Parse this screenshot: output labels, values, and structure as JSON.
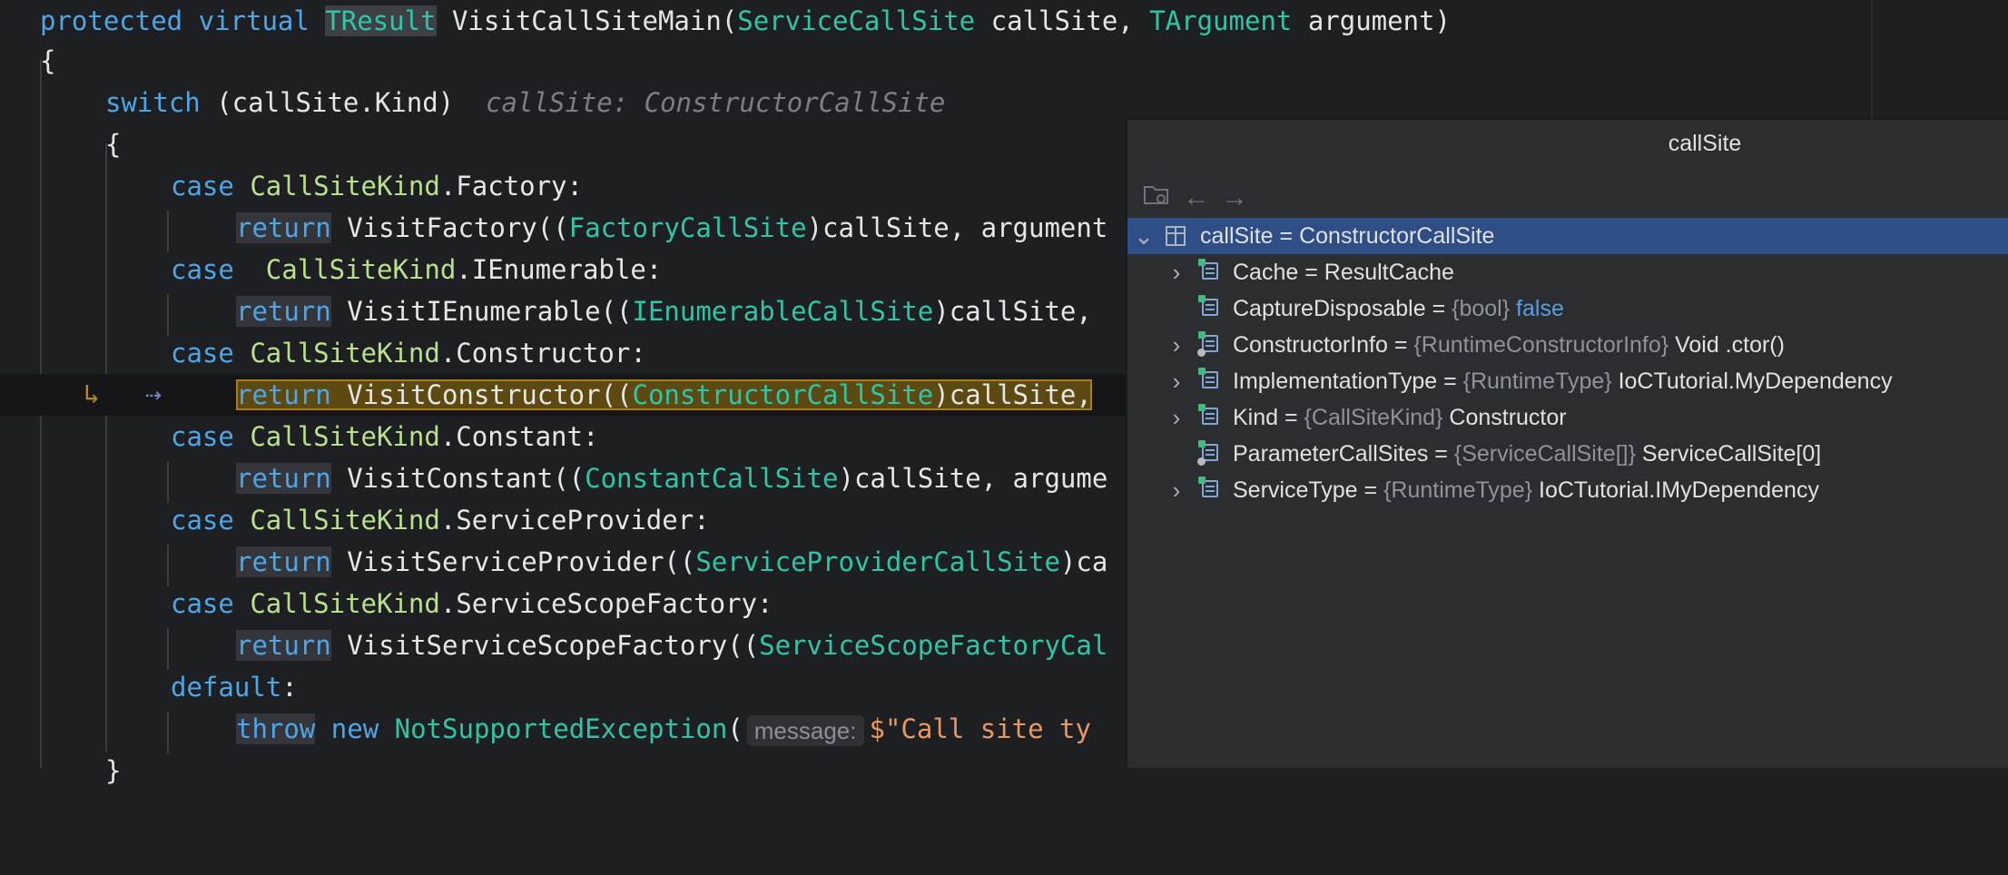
{
  "editor": {
    "lines": {
      "l1": {
        "kw1": "protected",
        "kw2": "virtual",
        "type": "TResult",
        "rest1": " VisitCallSiteMain(",
        "t2": "ServiceCallSite",
        "rest2": " callSite, ",
        "t3": "TArgument",
        "rest3": " argument)"
      },
      "l2": {
        "text": "{"
      },
      "l3": {
        "kw": "switch",
        "rest": " (callSite.Kind)",
        "hint": "callSite: ConstructorCallSite"
      },
      "l4": {
        "text": "{"
      },
      "l5": {
        "kw": "case",
        "enum": "CallSiteKind",
        "rest": ".Factory:"
      },
      "l6": {
        "kw": "return",
        "rest1": " VisitFactory((",
        "type": "FactoryCallSite",
        "rest2": ")callSite, argument"
      },
      "l7": {
        "kw": "case",
        "enum": "CallSiteKind",
        "rest": ".IEnumerable:"
      },
      "l8": {
        "kw": "return",
        "rest1": " VisitIEnumerable((",
        "type": "IEnumerableCallSite",
        "rest2": ")callSite,"
      },
      "l9": {
        "kw": "case",
        "enum": "CallSiteKind",
        "rest": ".Constructor:"
      },
      "l10": {
        "kw": "return",
        "rest1": " VisitConstructor((",
        "type": "ConstructorCallSite",
        "rest2": ")callSite,"
      },
      "l11": {
        "kw": "case",
        "enum": "CallSiteKind",
        "rest": ".Constant:"
      },
      "l12": {
        "kw": "return",
        "rest1": " VisitConstant((",
        "type": "ConstantCallSite",
        "rest2": ")callSite, argume"
      },
      "l13": {
        "kw": "case",
        "enum": "CallSiteKind",
        "rest": ".ServiceProvider:"
      },
      "l14": {
        "kw": "return",
        "rest1": " VisitServiceProvider((",
        "type": "ServiceProviderCallSite",
        "rest2": ")ca"
      },
      "l15": {
        "kw": "case",
        "enum": "CallSiteKind",
        "rest": ".ServiceScopeFactory:"
      },
      "l16": {
        "kw": "return",
        "rest1": " VisitServiceScopeFactory((",
        "type": "ServiceScopeFactoryCal"
      },
      "l17": {
        "kw": "default",
        "rest": ":"
      },
      "l18": {
        "kw1": "throw",
        "kw2": "new",
        "type": "NotSupportedException",
        "rest1": "(",
        "hint": "message:",
        "str": "$\"Call site ty"
      },
      "l19": {
        "text": "}"
      }
    }
  },
  "popup": {
    "title": "callSite",
    "root": {
      "name": "callSite",
      "eq": " = ",
      "value": "ConstructorCallSite"
    },
    "rows": [
      {
        "name": "Cache",
        "eq": " = ",
        "type": "",
        "value": "ResultCache",
        "expandable": true
      },
      {
        "name": "CaptureDisposable",
        "eq": " = ",
        "type": "{bool}",
        "value": "false",
        "expandable": false
      },
      {
        "name": "ConstructorInfo",
        "eq": " = ",
        "type": "{RuntimeConstructorInfo}",
        "value": "Void .ctor()",
        "expandable": true
      },
      {
        "name": "ImplementationType",
        "eq": " = ",
        "type": "{RuntimeType}",
        "value": "IoCTutorial.MyDependency",
        "expandable": true
      },
      {
        "name": "Kind",
        "eq": " = ",
        "type": "{CallSiteKind}",
        "value": "Constructor",
        "expandable": true
      },
      {
        "name": "ParameterCallSites",
        "eq": " = ",
        "type": "{ServiceCallSite[]}",
        "value": "ServiceCallSite[0]",
        "expandable": false
      },
      {
        "name": "ServiceType",
        "eq": " = ",
        "type": "{RuntimeType}",
        "value": "IoCTutorial.IMyDependency",
        "expandable": true
      }
    ],
    "icons": {
      "toolbar": [
        "folder-icon",
        "arrow-left-icon",
        "arrow-right-icon"
      ],
      "field": "field-icon",
      "object": "object-icon"
    }
  },
  "colors": {
    "background": "#1e1f22",
    "keyword": "#4ea6e6",
    "type": "#2fc6a8",
    "enum": "#b9e08a",
    "string": "#e79a63",
    "selection": "#2f4e86",
    "execution_highlight": "#5c4a12"
  }
}
